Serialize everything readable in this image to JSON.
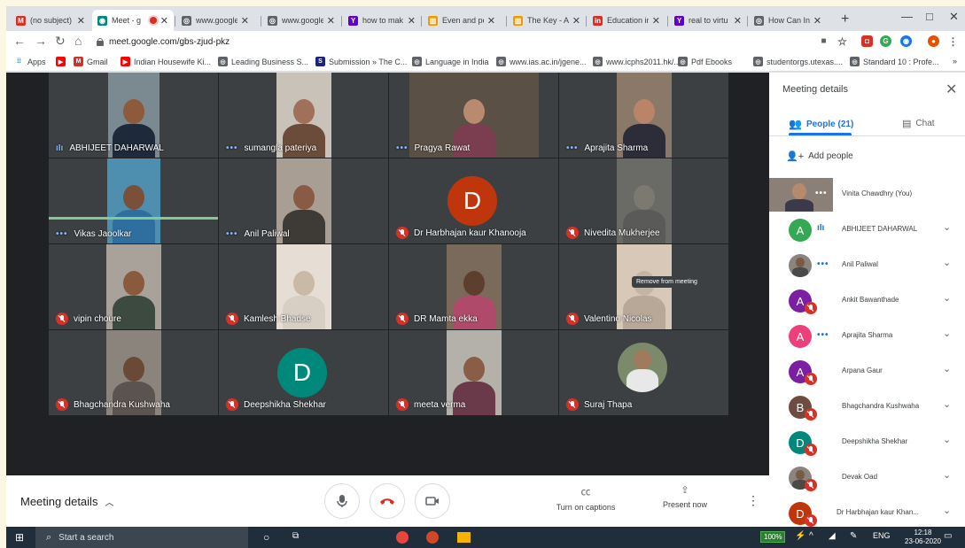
{
  "browser": {
    "tabs": [
      {
        "title": "(no subject)",
        "icon": "gmail-icon",
        "color": "#d93025",
        "glyph": "M"
      },
      {
        "title": "Meet - g",
        "icon": "meet-icon",
        "color": "#00897b",
        "glyph": "◉",
        "active": true
      },
      {
        "title": "www.google",
        "icon": "globe-icon",
        "color": "#5f6368",
        "glyph": "◎"
      },
      {
        "title": "www.google",
        "icon": "globe-icon",
        "color": "#5f6368",
        "glyph": "◎"
      },
      {
        "title": "how to mak",
        "icon": "yahoo-icon",
        "color": "#6001d2",
        "glyph": "Y"
      },
      {
        "title": "Even and pe",
        "icon": "book-icon",
        "color": "#f29900",
        "glyph": "▥"
      },
      {
        "title": "The Key - A",
        "icon": "book-icon",
        "color": "#f29900",
        "glyph": "▥"
      },
      {
        "title": "Education in",
        "icon": "linkedin-icon",
        "color": "#d93025",
        "glyph": "in"
      },
      {
        "title": "real to virtu",
        "icon": "yahoo-icon",
        "color": "#6001d2",
        "glyph": "Y"
      },
      {
        "title": "How Can In",
        "icon": "globe-icon",
        "color": "#5f6368",
        "glyph": "◎"
      }
    ],
    "url": "meet.google.com/gbs-zjud-pkz",
    "bookmarks": [
      {
        "label": "Apps",
        "icon": "apps-icon",
        "color": "#1a73e8",
        "glyph": "⁞⁞"
      },
      {
        "label": "",
        "icon": "youtube-icon",
        "color": "#ff0000",
        "glyph": "▶"
      },
      {
        "label": "Gmail",
        "icon": "gmail-icon",
        "color": "#d93025",
        "glyph": "M"
      },
      {
        "label": "Indian Housewife Ki...",
        "icon": "youtube-icon",
        "color": "#ff0000",
        "glyph": "▶"
      },
      {
        "label": "Leading Business S...",
        "icon": "globe-icon",
        "color": "#5f6368",
        "glyph": "◎"
      },
      {
        "label": "Submission » The C...",
        "icon": "bookmark-icon",
        "color": "#1a237e",
        "glyph": "S"
      },
      {
        "label": "Language in India",
        "icon": "globe-icon",
        "color": "#5f6368",
        "glyph": "◎"
      },
      {
        "label": "www.ias.ac.in/jgene...",
        "icon": "globe-icon",
        "color": "#5f6368",
        "glyph": "◎"
      },
      {
        "label": "www.icphs2011.hk/...",
        "icon": "globe-icon",
        "color": "#5f6368",
        "glyph": "◎"
      },
      {
        "label": "Pdf Ebooks",
        "icon": "globe-icon",
        "color": "#5f6368",
        "glyph": "◎"
      },
      {
        "label": "studentorgs.utexas....",
        "icon": "globe-icon",
        "color": "#5f6368",
        "glyph": "◎"
      },
      {
        "label": "Standard 10 : Profe...",
        "icon": "globe-icon",
        "color": "#5f6368",
        "glyph": "◎"
      }
    ],
    "more_bookmarks": "»"
  },
  "meet": {
    "tiles": [
      {
        "name": "ABHIJEET DAHARWAL",
        "status": "speaking",
        "bg": "#7b8a91",
        "skin": "#8d5a3b",
        "shirt": "#1e2a3a",
        "vw": 58
      },
      {
        "name": "sumangla pateriya",
        "status": "dots",
        "bg": "#c9c2b8",
        "skin": "#a0705a",
        "shirt": "#6b4c3a",
        "vw": 62
      },
      {
        "name": "Pragya Rawat",
        "status": "dots",
        "bg": "#5a5045",
        "skin": "#b98a6e",
        "shirt": "#7a3e50",
        "vw": 146
      },
      {
        "name": "Aprajita Sharma",
        "status": "dots",
        "bg": "#8a7868",
        "skin": "#b98467",
        "shirt": "#2d2d3a",
        "vw": 62
      },
      {
        "name": "Vikas Jaoolkar",
        "status": "dots",
        "bg": "#4e8fb0",
        "skin": "#7a5038",
        "shirt": "#2f6fa0",
        "vw": 60
      },
      {
        "name": "Anil Paliwal",
        "status": "dots",
        "bg": "#a99e94",
        "skin": "#8a5b44",
        "shirt": "#3e3a36",
        "vw": 62
      },
      {
        "name": "Dr Harbhajan kaur Khanooja",
        "status": "muted",
        "avatar": "D",
        "avatar_color": "#bf360c"
      },
      {
        "name": "Nivedita Mukherjee",
        "status": "muted",
        "bg": "#6a6a66",
        "skin": "#7c7a70",
        "shirt": "#5a5a58",
        "vw": 62
      },
      {
        "name": "vipin choure",
        "status": "muted",
        "bg": "#a8a29a",
        "skin": "#8a5a3e",
        "shirt": "#3c4a40",
        "vw": 62
      },
      {
        "name": "Kamlesh Bhadse",
        "status": "muted",
        "bg": "#e6ded4",
        "skin": "#c9b9a6",
        "shirt": "#d8cfc4",
        "vw": 62
      },
      {
        "name": "DR Mamta ekka",
        "status": "muted",
        "bg": "#7a6a5c",
        "skin": "#5e3e2c",
        "shirt": "#b04a6a",
        "vw": 62
      },
      {
        "name": "Valentino Nicolas",
        "status": "muted",
        "bg": "#d8c8b8",
        "skin": "#c4b4a4",
        "shirt": "#b8a898",
        "vw": 62
      },
      {
        "name": "Bhagchandra Kushwaha",
        "status": "muted",
        "bg": "#8a847c",
        "skin": "#6a4a36",
        "shirt": "#5a5450",
        "vw": 62
      },
      {
        "name": "Deepshikha Shekhar",
        "status": "muted",
        "avatar": "D",
        "avatar_color": "#00897b"
      },
      {
        "name": "meeta verma",
        "status": "muted",
        "bg": "#b4b0aa",
        "skin": "#8a5e46",
        "shirt": "#6a3a4a",
        "vw": 62
      },
      {
        "name": "Suraj Thapa",
        "status": "muted",
        "circle": true,
        "bg": "#7a8a6a",
        "skin": "#a07a5a",
        "shirt": "#e8e8e8"
      }
    ],
    "tooltip": "Remove from meeting",
    "bottom": {
      "meeting_details": "Meeting details",
      "captions_label": "Turn on captions",
      "present_label": "Present now"
    }
  },
  "panel": {
    "title": "Meeting details",
    "people_tab": "People (21)",
    "chat_tab": "Chat",
    "add_people": "Add people",
    "people": [
      {
        "name": "Vinita Chawdhry (You)",
        "self": true,
        "status": "dots"
      },
      {
        "name": "ABHIJEET DAHARWAL",
        "avatar": "A",
        "color": "#34a853",
        "status": "speaking"
      },
      {
        "name": "Anil Paliwal",
        "photo": true,
        "status": "dots"
      },
      {
        "name": "Ankit Bawanthade",
        "avatar": "A",
        "color": "#7b1fa2",
        "status": "muted"
      },
      {
        "name": "Aprajita Sharma",
        "avatar": "A",
        "color": "#ec407a",
        "status": "dots"
      },
      {
        "name": "Arpana Gaur",
        "avatar": "A",
        "color": "#7b1fa2",
        "status": "muted"
      },
      {
        "name": "Bhagchandra Kushwaha",
        "avatar": "B",
        "color": "#6d4c41",
        "status": "muted"
      },
      {
        "name": "Deepshikha Shekhar",
        "avatar": "D",
        "color": "#00897b",
        "status": "muted"
      },
      {
        "name": "Devak Oad",
        "photo": true,
        "status": "muted"
      },
      {
        "name": "Dr Harbhajan kaur Khan...",
        "avatar": "D",
        "color": "#bf360c",
        "status": "muted"
      }
    ]
  },
  "taskbar": {
    "search_placeholder": "Start a search",
    "battery": "100%",
    "lang": "ENG",
    "time": "12:18",
    "date": "23-06-2020"
  }
}
